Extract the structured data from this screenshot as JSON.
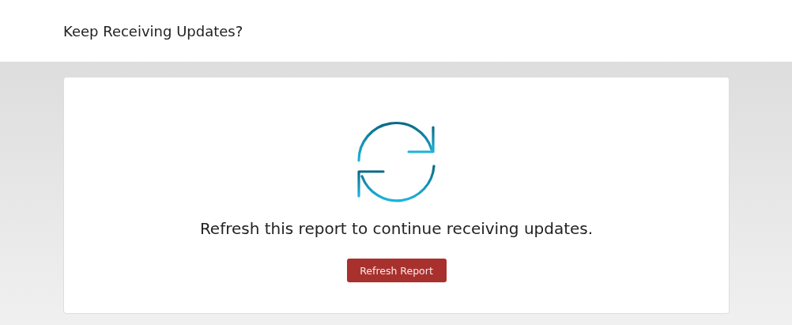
{
  "header": {
    "title": "Keep Receiving Updates?"
  },
  "card": {
    "message": "Refresh this report to continue receiving updates.",
    "button": "Refresh Report"
  }
}
